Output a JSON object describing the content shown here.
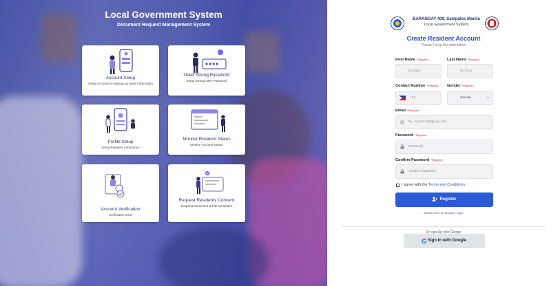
{
  "left": {
    "title": "Local Government System",
    "subtitle": "Document Request Management System",
    "cards": [
      {
        "title": "Account Setup",
        "desc": "Setup Account by signing up basic information"
      },
      {
        "title": "Used Strong Password",
        "desc": "Setup Strong User Password"
      },
      {
        "title": "Profile Setup",
        "desc": "Setup Resident Information"
      },
      {
        "title": "Monitor Resident Status",
        "desc": "Monitor Account Status"
      },
      {
        "title": "Account Verification",
        "desc": "Verification Done"
      },
      {
        "title": "Request Residents Concern",
        "desc": "Request Document & File Complaint"
      }
    ]
  },
  "brand": {
    "line1": "BARANGAY 409, Sampaloc Manila",
    "line2": "Local Government System"
  },
  "form": {
    "title": "Create Resident Account",
    "subtitle": "Please Fill up the information",
    "required": "*Required",
    "first_name": {
      "label": "First Name",
      "placeholder": "Ex.Juan"
    },
    "last_name": {
      "label": "Last Name",
      "placeholder": "Ex.Cruz"
    },
    "contact": {
      "label": "Contact Number",
      "prefix": "+63"
    },
    "gender": {
      "label": "Gender",
      "value": "Gender"
    },
    "email": {
      "label": "Email",
      "placeholder": "Ex. JuanCruz@gmail.com"
    },
    "password": {
      "label": "Password",
      "placeholder": "Password"
    },
    "confirm": {
      "label": "Confirm Password",
      "placeholder": "Confirm Password"
    },
    "agree_text": "I agree with the",
    "terms_link": "Terms and Conditions",
    "register": "Register",
    "already_text": "Already have an account?",
    "login_link": "Login",
    "or_text": "Or sign Up with Google",
    "google_btn": "Sign In with Google"
  },
  "colors": {
    "accent": "#2a5ad8",
    "title": "#2a4fb8",
    "required": "#d4201a",
    "overlay": "#3a44b4"
  }
}
